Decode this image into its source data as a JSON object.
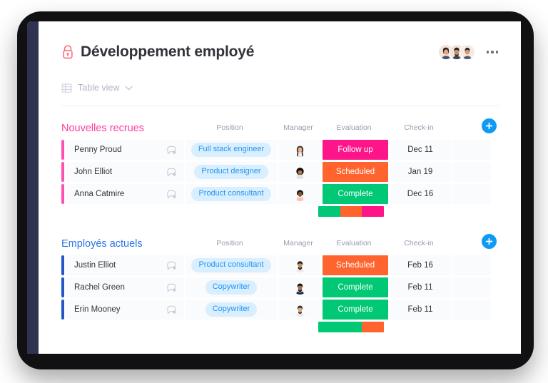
{
  "board": {
    "title": "Développement employé",
    "lock_icon": "lock-icon",
    "lock_color": "#ff6b7a",
    "kebab_icon": "more-options-icon",
    "collaborators": [
      {
        "name": "collaborator-avatar-1"
      },
      {
        "name": "collaborator-avatar-2"
      },
      {
        "name": "collaborator-avatar-3"
      }
    ]
  },
  "toolbar": {
    "view_icon": "table-view-icon",
    "view_label": "Table view",
    "chevron_icon": "chevron-down-icon"
  },
  "colors": {
    "accent_blue": "#0f9bf5",
    "group_pink": "#ff3d9a",
    "group_blue": "#2b76e5",
    "row_pink": "#ff4fb0",
    "row_blue": "#2457c5",
    "status_follow_up": "#ff158a",
    "status_scheduled": "#ff642e",
    "status_complete": "#00c875",
    "pill_bg": "#d9eefe",
    "pill_text": "#2196f3"
  },
  "columns": {
    "name": "",
    "position": "Position",
    "manager": "Manager",
    "evaluation": "Evaluation",
    "checkin": "Check-in"
  },
  "groups": [
    {
      "id": "nouvelles-recrues",
      "title": "Nouvelles recrues",
      "color": "#ff3d9a",
      "accent": "pink",
      "add_label": "+",
      "rows": [
        {
          "name": "Penny Proud",
          "position": "Full stack engineer",
          "manager": "manager-avatar-penny",
          "evaluation": "Follow up",
          "evaluation_color": "#ff158a",
          "checkin": "Dec 11",
          "conversation_icon": "chat-bubble-icon"
        },
        {
          "name": "John Elliot",
          "position": "Product designer",
          "manager": "manager-avatar-john",
          "evaluation": "Scheduled",
          "evaluation_color": "#ff642e",
          "checkin": "Jan 19",
          "conversation_icon": "chat-bubble-icon"
        },
        {
          "name": "Anna Catmire",
          "position": "Product consultant",
          "manager": "manager-avatar-anna",
          "evaluation": "Complete",
          "evaluation_color": "#00c875",
          "checkin": "Dec 16",
          "conversation_icon": "chat-bubble-icon"
        }
      ],
      "summary": [
        {
          "label": "Complete",
          "color": "#00c875",
          "percent": 33.3
        },
        {
          "label": "Scheduled",
          "color": "#ff642e",
          "percent": 33.3
        },
        {
          "label": "Follow up",
          "color": "#ff158a",
          "percent": 33.4
        }
      ]
    },
    {
      "id": "employes-actuels",
      "title": "Employés actuels",
      "color": "#2b76e5",
      "accent": "blue",
      "add_label": "+",
      "rows": [
        {
          "name": "Justin Elliot",
          "position": "Product consultant",
          "manager": "manager-avatar-justin",
          "evaluation": "Scheduled",
          "evaluation_color": "#ff642e",
          "checkin": "Feb 16",
          "conversation_icon": "chat-bubble-icon"
        },
        {
          "name": "Rachel Green",
          "position": "Copywriter",
          "manager": "manager-avatar-rachel",
          "evaluation": "Complete",
          "evaluation_color": "#00c875",
          "checkin": "Feb 11",
          "conversation_icon": "chat-bubble-icon"
        },
        {
          "name": "Erin Mooney",
          "position": "Copywriter",
          "manager": "manager-avatar-erin",
          "evaluation": "Complete",
          "evaluation_color": "#00c875",
          "checkin": "Feb 11",
          "conversation_icon": "chat-bubble-icon"
        }
      ],
      "summary": [
        {
          "label": "Complete",
          "color": "#00c875",
          "percent": 66.7
        },
        {
          "label": "Scheduled",
          "color": "#ff642e",
          "percent": 33.3
        }
      ]
    }
  ]
}
